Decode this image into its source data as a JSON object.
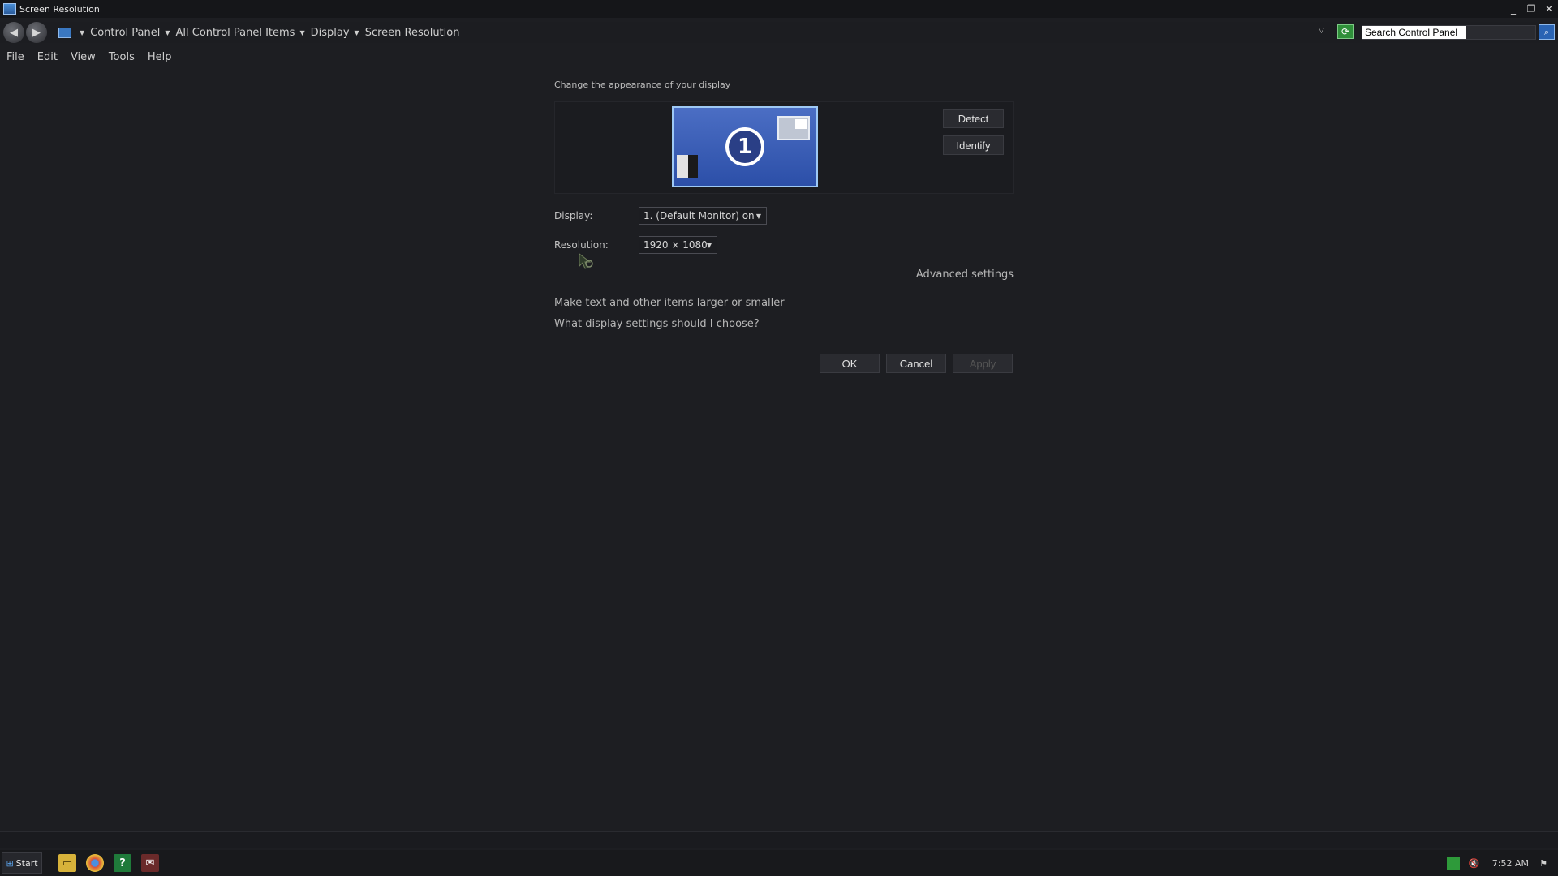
{
  "window": {
    "title": "Screen Resolution",
    "controls": {
      "minimize": "_",
      "restore": "❐",
      "close": "✕"
    }
  },
  "address": {
    "breadcrumbs": [
      "Control Panel",
      "All Control Panel Items",
      "Display",
      "Screen Resolution"
    ],
    "search_value": "Search Control Panel"
  },
  "menu": {
    "items": [
      "File",
      "Edit",
      "View",
      "Tools",
      "Help"
    ]
  },
  "content": {
    "heading": "Change the appearance of your display",
    "monitor_number": "1",
    "detect_label": "Detect",
    "identify_label": "Identify",
    "display_label": "Display:",
    "display_value": "1. (Default Monitor) on",
    "resolution_label": "Resolution:",
    "resolution_value": "1920 × 1080",
    "advanced_link": "Advanced settings",
    "link_text_size": "Make text and other items larger or smaller",
    "link_help": "What display settings should I choose?",
    "ok_label": "OK",
    "cancel_label": "Cancel",
    "apply_label": "Apply"
  },
  "taskbar": {
    "start_label": "Start",
    "clock": "7:52 AM",
    "icons": [
      "folder-icon",
      "chrome-icon",
      "help-icon",
      "app-icon"
    ]
  },
  "colors": {
    "background": "#1d1e22",
    "monitor_fill": "#3b5fb8",
    "monitor_border": "#9ec9f5"
  }
}
